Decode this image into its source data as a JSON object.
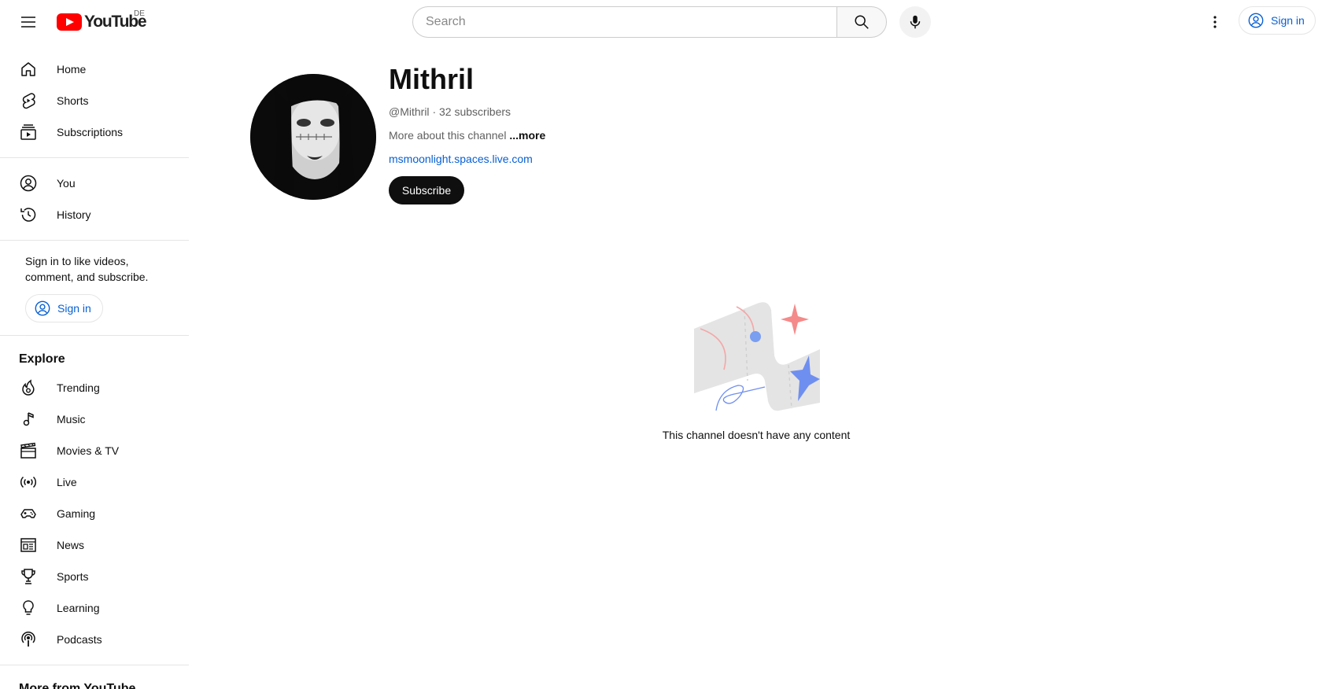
{
  "masthead": {
    "logo_text": "YouTube",
    "country_code": "DE",
    "search_placeholder": "Search",
    "signin_label": "Sign in"
  },
  "sidebar": {
    "main": [
      {
        "label": "Home",
        "icon": "home-icon"
      },
      {
        "label": "Shorts",
        "icon": "shorts-icon"
      },
      {
        "label": "Subscriptions",
        "icon": "subscriptions-icon"
      }
    ],
    "you": [
      {
        "label": "You",
        "icon": "account-icon"
      },
      {
        "label": "History",
        "icon": "history-icon"
      }
    ],
    "signin_prompt": "Sign in to like videos, comment, and subscribe.",
    "signin_label": "Sign in",
    "explore_title": "Explore",
    "explore": [
      {
        "label": "Trending",
        "icon": "trending-icon"
      },
      {
        "label": "Music",
        "icon": "music-icon"
      },
      {
        "label": "Movies & TV",
        "icon": "movies-icon"
      },
      {
        "label": "Live",
        "icon": "live-icon"
      },
      {
        "label": "Gaming",
        "icon": "gaming-icon"
      },
      {
        "label": "News",
        "icon": "news-icon"
      },
      {
        "label": "Sports",
        "icon": "sports-icon"
      },
      {
        "label": "Learning",
        "icon": "learning-icon"
      },
      {
        "label": "Podcasts",
        "icon": "podcasts-icon"
      }
    ],
    "more_title": "More from YouTube"
  },
  "channel": {
    "name": "Mithril",
    "handle": "@Mithril",
    "separator": "·",
    "subscribers": "32 subscribers",
    "description": "More about this channel",
    "more_label": "...more",
    "link": "msmoonlight.spaces.live.com",
    "subscribe_label": "Subscribe"
  },
  "empty_state": {
    "text": "This channel doesn't have any content"
  },
  "colors": {
    "brand_red": "#ff0000",
    "link_blue": "#065fd4",
    "text_primary": "#0f0f0f",
    "text_secondary": "#606060"
  }
}
